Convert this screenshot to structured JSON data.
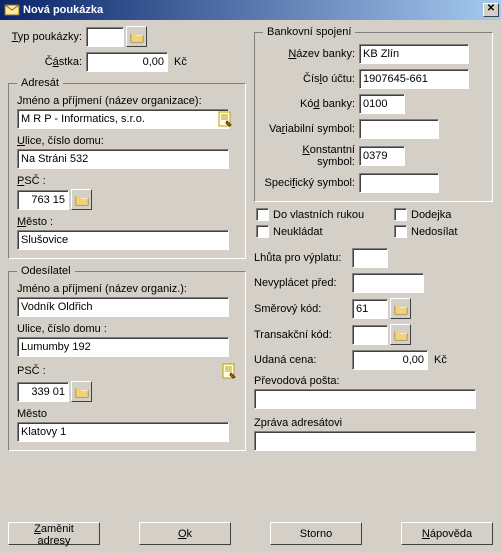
{
  "title": "Nová poukázka",
  "labels": {
    "typ": "Typ poukázky:",
    "castka": "Částka:",
    "kc": "Kč"
  },
  "values": {
    "typ": "",
    "castka": "0,00"
  },
  "adresat": {
    "legend": "Adresát",
    "jmeno_lbl": "Jméno a příjmení (název organizace):",
    "jmeno": "M R P - Informatics, s.r.o.",
    "ulice_lbl": "Ulice, číslo domu:",
    "ulice": "Na Stráni 532",
    "psc_lbl": "PSČ :",
    "psc": "763 15",
    "mesto_lbl": "Město :",
    "mesto": "Slušovice"
  },
  "odesilatel": {
    "legend": "Odesílatel",
    "jmeno_lbl": "Jméno a příjmení (název organiz.):",
    "jmeno": "Vodník Oldřich",
    "ulice_lbl": "Ulice, číslo domu :",
    "ulice": "Lumumby 192",
    "psc_lbl": "PSČ :",
    "psc": "339 01",
    "mesto_lbl": "Město",
    "mesto": "Klatovy 1"
  },
  "bank": {
    "legend": "Bankovní spojení",
    "nazev_lbl": "Název banky:",
    "nazev": "KB Zlín",
    "cislo_lbl": "Číslo účtu:",
    "cislo": "1907645-661",
    "kod_lbl": "Kód banky:",
    "kod": "0100",
    "var_lbl": "Variabilní symbol:",
    "var": "",
    "konst_lbl": "Konstantní symbol:",
    "konst": "0379",
    "spec_lbl": "Specifický symbol:",
    "spec": ""
  },
  "checks": {
    "dovlast": "Do vlastních rukou",
    "dodejka": "Dodejka",
    "neukladat": "Neukládat",
    "nedosilat": "Nedosílat"
  },
  "extra": {
    "lhuta_lbl": "Lhůta pro výplatu:",
    "lhuta": "",
    "nevyplacet_lbl": "Nevyplácet před:",
    "nevyplacet": "",
    "smer_lbl": "Směrový kód:",
    "smer": "61",
    "trans_lbl": "Transakční kód:",
    "trans": "",
    "cena_lbl": "Udaná cena:",
    "cena": "0,00",
    "kc": "Kč",
    "prevod_lbl": "Převodová pošta:",
    "prevod": "",
    "zprava_lbl": "Zpráva adresátovi",
    "zprava": ""
  },
  "buttons": {
    "zamenit": "Zaměnit adresy",
    "ok": "Ok",
    "storno": "Storno",
    "napoveda": "Nápověda"
  }
}
